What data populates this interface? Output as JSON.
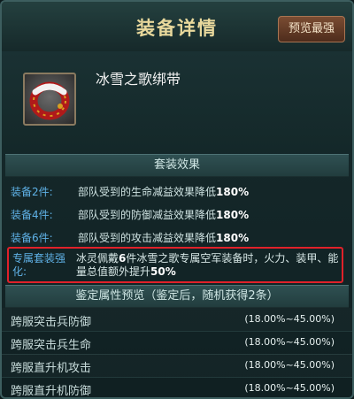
{
  "header": {
    "title": "装备详情",
    "preview_button": "预览最强"
  },
  "item": {
    "name": "冰雪之歌绑带",
    "icon": "red-ring-band-icon"
  },
  "set_effect": {
    "section_title": "套装效果",
    "rows": [
      {
        "label": "装备2件:",
        "desc": "部队受到的生命减益效果降低",
        "value": "180%"
      },
      {
        "label": "装备4件:",
        "desc": "部队受到的防御减益效果降低",
        "value": "180%"
      },
      {
        "label": "装备6件:",
        "desc": "部队受到的攻击减益效果降低",
        "value": "180%"
      }
    ],
    "exclusive": {
      "label": "专属套装强化:",
      "desc_prefix": "冰灵佩戴",
      "desc_count": "6",
      "desc_middle": "件冰雪之歌专属空军装备时，火力、装甲、能量总值额外提升",
      "desc_value": "50%"
    }
  },
  "appraisal": {
    "section_title": "鉴定属性预览（鉴定后，随机获得2条）",
    "attributes": [
      {
        "name": "跨服突击兵防御",
        "range": "(18.00%~45.00%)"
      },
      {
        "name": "跨服突击兵生命",
        "range": "(18.00%~45.00%)"
      },
      {
        "name": "跨服直升机攻击",
        "range": "(18.00%~45.00%)"
      },
      {
        "name": "跨服直升机防御",
        "range": "(18.00%~45.00%)"
      }
    ]
  },
  "colors": {
    "title": "#e8d89c",
    "label": "#5fb1e6",
    "highlight_border": "#e0212a"
  }
}
